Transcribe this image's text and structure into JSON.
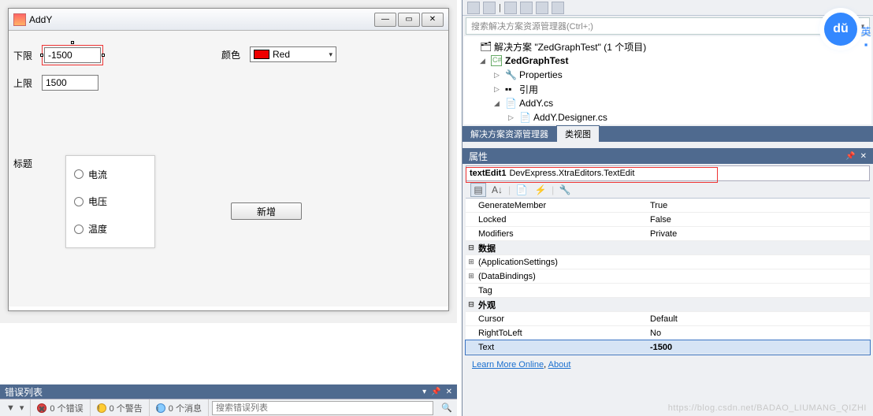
{
  "win": {
    "title": "AddY",
    "lower_label": "下限",
    "lower_value": "-1500",
    "upper_label": "上限",
    "upper_value": "1500",
    "color_label": "颜色",
    "color_value": "Red",
    "title_label": "标题",
    "radios": {
      "r1": "电流",
      "r2": "电压",
      "r3": "温度"
    },
    "add_btn": "新增"
  },
  "errlist": {
    "tab": "错误列表",
    "errors": "0 个错误",
    "warnings": "0 个警告",
    "messages": "0 个消息",
    "search_placeholder": "搜索错误列表"
  },
  "sol": {
    "search_placeholder": "搜索解决方案资源管理器(Ctrl+;)",
    "root": "解决方案 \"ZedGraphTest\" (1 个项目)",
    "proj": "ZedGraphTest",
    "n1": "Properties",
    "n2": "引用",
    "n3": "AddY.cs",
    "n4": "AddY.Designer.cs",
    "tab1": "解决方案资源管理器",
    "tab2": "类视图"
  },
  "prop": {
    "header": "属性",
    "obj_name": "textEdit1",
    "obj_type": "DevExpress.XtraEditors.TextEdit",
    "rows": {
      "gm_k": "GenerateMember",
      "gm_v": "True",
      "lk_k": "Locked",
      "lk_v": "False",
      "md_k": "Modifiers",
      "md_v": "Private",
      "cat_data": "数据",
      "as_k": "(ApplicationSettings)",
      "db_k": "(DataBindings)",
      "tg_k": "Tag",
      "cat_look": "外观",
      "cu_k": "Cursor",
      "cu_v": "Default",
      "rl_k": "RightToLeft",
      "rl_v": "No",
      "tx_k": "Text",
      "tx_v": "-1500"
    },
    "link1": "Learn More Online",
    "link2": "About"
  },
  "baidu": {
    "logo": "dŭ",
    "side": "英  ▪"
  },
  "watermark": "https://blog.csdn.net/BADAO_LIUMANG_QIZHI"
}
